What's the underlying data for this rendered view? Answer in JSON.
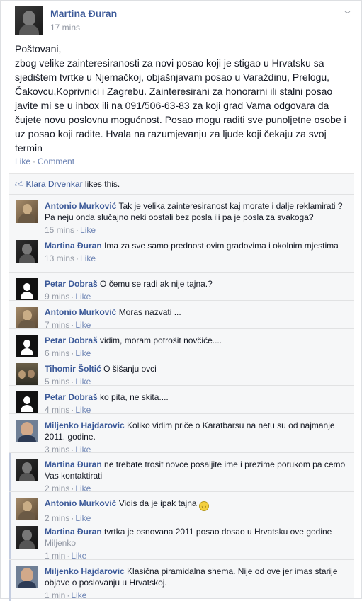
{
  "post": {
    "author": "Martina Đuran",
    "timestamp": "17 mins",
    "text_lines": [
      "Poštovani,",
      "zbog velike zainteresiranosti za novi posao koji je stigao u Hrvatsku sa sjedištem tvrtke u Njemačkoj, objašnjavam posao u Varaždinu, Prelogu, Čakovcu,Koprivnici i Zagrebu. Zainteresirani za honorarni ili stalni posao javite mi se u inbox ili na 091/506-63-83 za koji grad Vama odgovara da čujete novu poslovnu mogućnost. Posao mogu raditi sve punoljetne osobe i uz posao koji radite. Hvala na razumjevanju za ljude koji čekaju za svoj termin"
    ],
    "like_label": "Like",
    "comment_label": "Comment",
    "separator": "·",
    "menu_icon": "chevron-down-icon"
  },
  "likes": {
    "icon": "thumbs-up-icon",
    "liker": "Klara Drvenkar",
    "suffix": " likes this."
  },
  "comments": [
    {
      "author": "Antonio Murković",
      "text": "Tak je velika zainteresiranost kaj morate i dalje reklamirati ? Pa neju onda slučajno neki oostali bez posla ili pa je posla za svakoga?",
      "time": "15 mins",
      "like": "Like",
      "avatar": "antonio"
    },
    {
      "author": "Martina Đuran",
      "text": "Ima za sve samo prednost ovim gradovima i okolnim mjestima",
      "time": "13 mins",
      "like": "Like",
      "avatar": "martina"
    },
    {
      "author": "Petar Dobraš",
      "text": "O čemu se radi ak nije tajna.?",
      "time": "9 mins",
      "like": "Like",
      "avatar": "petar"
    },
    {
      "author": "Antonio Murković",
      "text": "Moras nazvati ...",
      "time": "7 mins",
      "like": "Like",
      "avatar": "antonio"
    },
    {
      "author": "Petar Dobraš",
      "text": "vidim, moram potrošit novčiće....",
      "time": "6 mins",
      "like": "Like",
      "avatar": "petar"
    },
    {
      "author": "Tihomir Šoltić",
      "text": "O šišanju ovci",
      "time": "5 mins",
      "like": "Like",
      "avatar": "tihomir"
    },
    {
      "author": "Petar Dobraš",
      "text": "ko pita, ne skita....",
      "time": "4 mins",
      "like": "Like",
      "avatar": "petar"
    },
    {
      "author": "Miljenko Hajdarovic",
      "text": "Koliko vidim priče o Karatbarsu na netu su od najmanje 2011. godine.",
      "time": "3 mins",
      "like": "Like",
      "avatar": "miljenko"
    },
    {
      "author": "Martina Đuran",
      "text": "ne trebate trosit novce posaljite ime i prezime porukom pa cemo Vas kontaktirati",
      "time": "2 mins",
      "like": "Like",
      "avatar": "martina"
    },
    {
      "author": "Antonio Murković",
      "text": "Vidis da je ipak tajna",
      "emoji": "smiley-emoji-icon",
      "time": "2 mins",
      "like": "Like",
      "avatar": "antonio"
    },
    {
      "author": "Martina Đuran",
      "text": "tvrtka je osnovana 2011 posao dosao u Hrvatsku ove godine",
      "tag": "Miljenko",
      "time": "1 min",
      "like": "Like",
      "avatar": "martina"
    },
    {
      "author": "Miljenko Hajdarovic",
      "text": "Klasična piramidalna shema. Nije od ove jer imas starije objave o poslovanju u Hrvatskoj.",
      "time": "1 min",
      "like": "Like",
      "avatar": "miljenko"
    }
  ],
  "colors": {
    "link": "#3b5998",
    "meta": "#9197a3",
    "action": "#6d84b4",
    "ufi_background": "#f6f7f8"
  }
}
